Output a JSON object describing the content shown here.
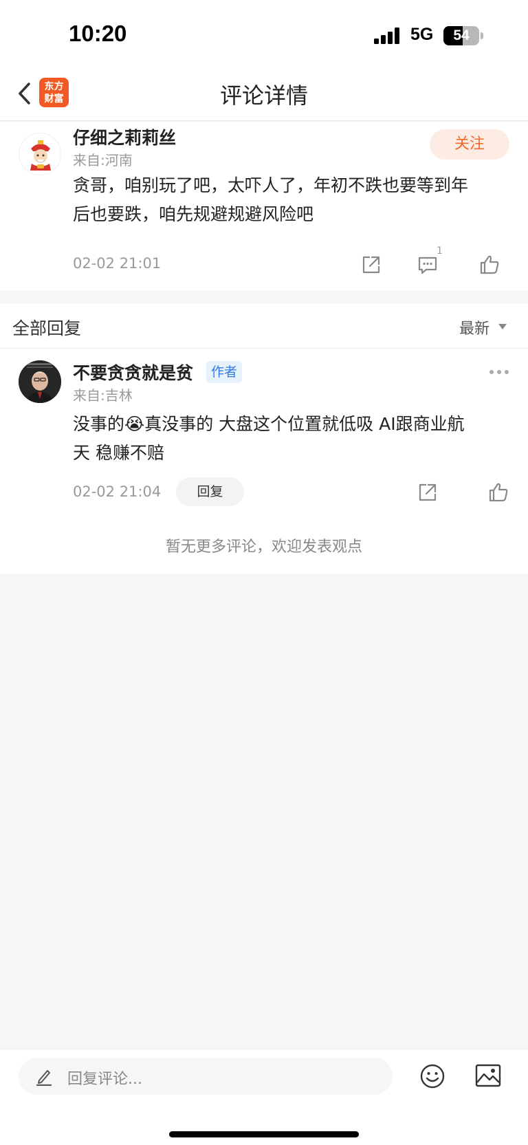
{
  "status_bar": {
    "time": "10:20",
    "network": "5G",
    "battery_level": "54"
  },
  "nav": {
    "title": "评论详情",
    "logo_line1": "东方",
    "logo_line2": "财富",
    "logo_color": "#f15a22"
  },
  "comment": {
    "user": "仔细之莉莉丝",
    "location": "来自:河南",
    "follow_label": "关注",
    "text_line1": "贪哥，咱别玩了吧，太吓人了，年初不跌也要等到年",
    "text_line2": "后也要跌，咱先规避规避风险吧",
    "time": "02-02 21:01",
    "reply_count": "1",
    "icons": [
      "share-icon",
      "comment-icon",
      "like-icon"
    ]
  },
  "replies": {
    "title": "全部回复",
    "sort_label": "最新",
    "items": [
      {
        "user": "不要贪贪就是贫",
        "badge": "作者",
        "location": "来自:吉林",
        "text_line1": "没事的😭真没事的 大盘这个位置就低吸 AI跟商业航",
        "text_line2": "天 稳赚不赔",
        "time": "02-02 21:04",
        "reply_label": "回复"
      }
    ],
    "no_more_text": "暂无更多评论，欢迎发表观点"
  },
  "bottom_bar": {
    "placeholder": "回复评论..."
  },
  "colors": {
    "accent": "#f26a2c",
    "author_badge": "#2f7be5"
  }
}
